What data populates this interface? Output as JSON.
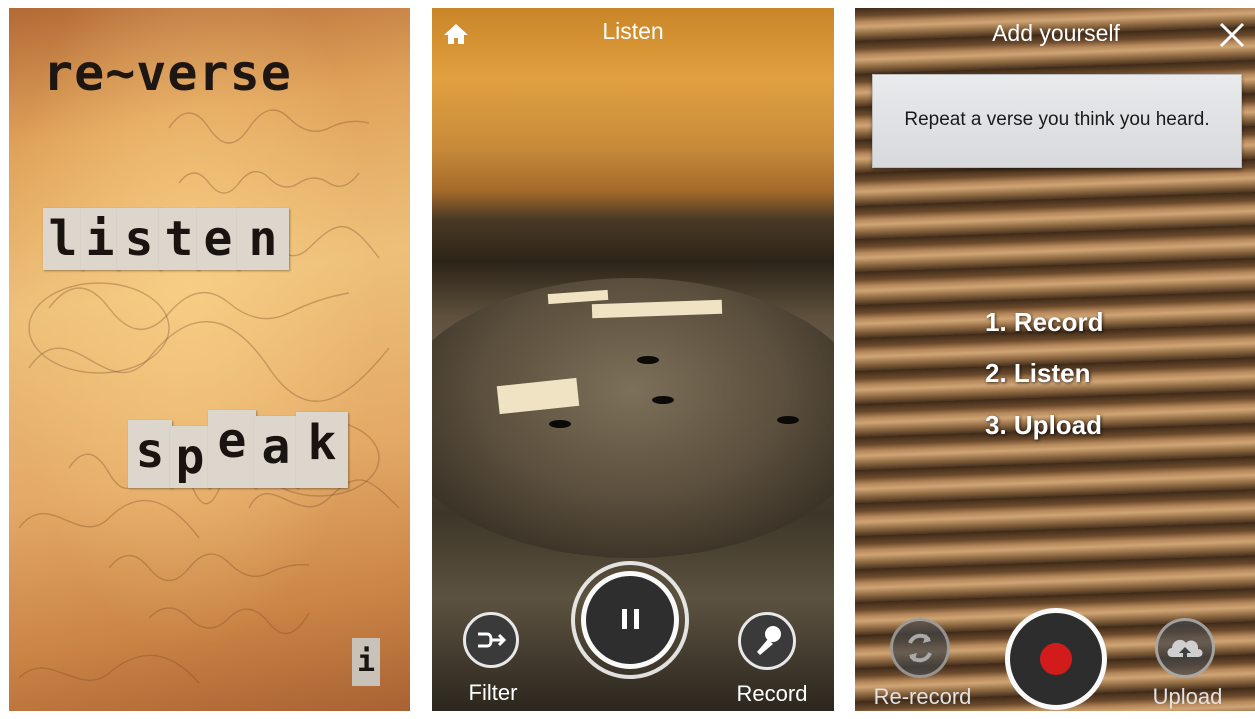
{
  "home_screen": {
    "logo": "re~verse",
    "listen_letters": [
      "l",
      "i",
      "s",
      "t",
      "e",
      "n"
    ],
    "speak_letters": [
      "s",
      "p",
      "e",
      "a",
      "k"
    ],
    "info_label": "i"
  },
  "listen_screen": {
    "title": "Listen",
    "home_icon": "home-icon",
    "filter_label": "Filter",
    "filter_icon": "shuffle-arrow-icon",
    "pause_icon": "pause-icon",
    "record_label": "Record",
    "record_icon": "microphone-icon"
  },
  "add_screen": {
    "title": "Add yourself",
    "close_icon": "close-icon",
    "instruction": "Repeat a verse you think you heard.",
    "steps": [
      "1. Record",
      "2. Listen",
      "3. Upload"
    ],
    "rerecord_label": "Re-record",
    "rerecord_icon": "refresh-icon",
    "upload_label": "Upload",
    "upload_icon": "cloud-upload-icon",
    "record_color": "#d21c1c"
  }
}
